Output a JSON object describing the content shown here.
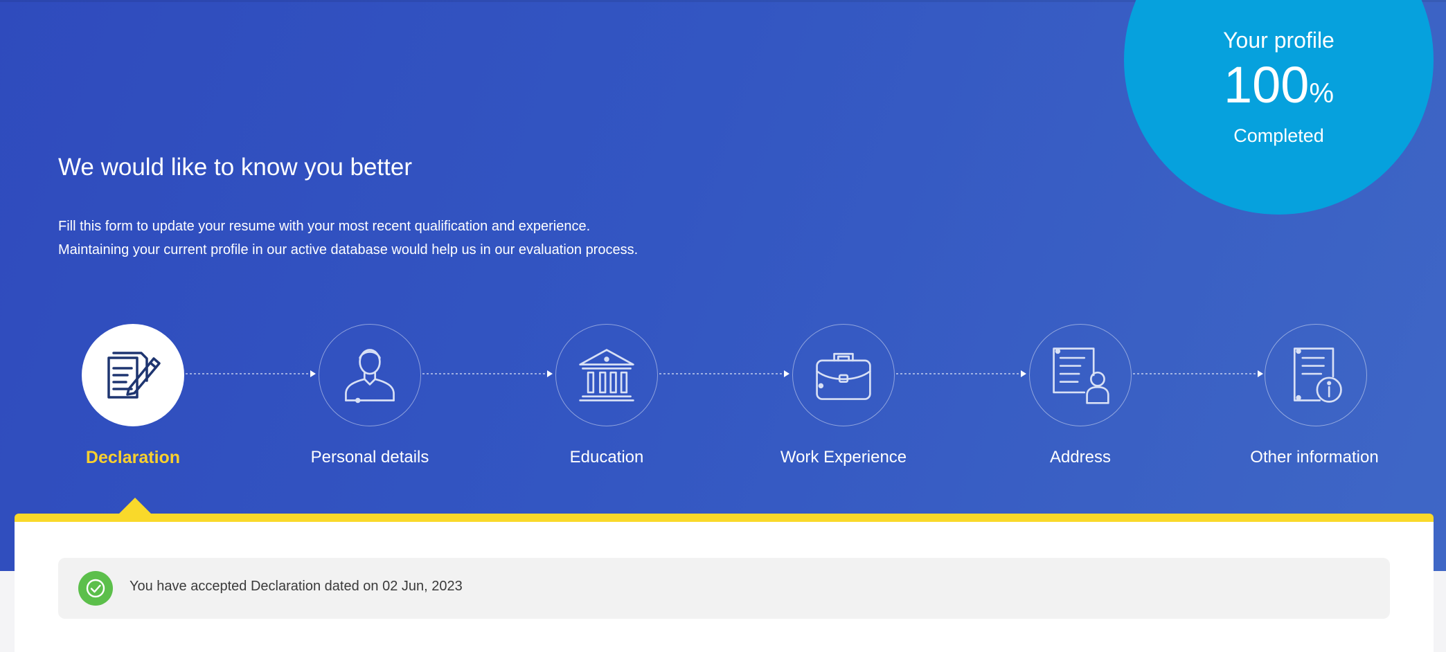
{
  "profile": {
    "title": "Your profile",
    "percent": "100",
    "percent_sign": "%",
    "status": "Completed"
  },
  "intro": {
    "headline": "We would like to know you better",
    "line1": "Fill this form to update your resume with your most recent qualification and experience.",
    "line2": "Maintaining your current profile in our active database would help us in our evaluation process."
  },
  "steps": [
    {
      "label": "Declaration",
      "icon": "declaration-icon",
      "active": true
    },
    {
      "label": "Personal details",
      "icon": "person-icon",
      "active": false
    },
    {
      "label": "Education",
      "icon": "institution-icon",
      "active": false
    },
    {
      "label": "Work Experience",
      "icon": "briefcase-icon",
      "active": false
    },
    {
      "label": "Address",
      "icon": "address-card-icon",
      "active": false
    },
    {
      "label": "Other information",
      "icon": "document-info-icon",
      "active": false
    }
  ],
  "notice": {
    "text": "You have accepted Declaration dated on 02 Jun, 2023",
    "icon": "check-icon"
  },
  "colors": {
    "hero_start": "#2f4bbd",
    "hero_end": "#3f67c6",
    "profile_circle": "#06a1dd",
    "active_label": "#f9d02e",
    "card_accent": "#f9d92a",
    "success": "#5cbf4b"
  }
}
